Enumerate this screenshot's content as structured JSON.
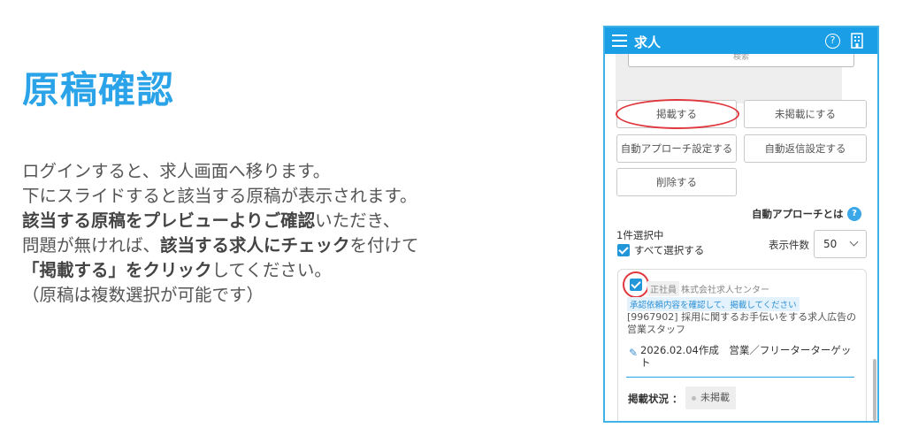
{
  "page": {
    "title": "原稿確認",
    "description": [
      [
        {
          "t": "ログインすると、求人画面へ移ります。",
          "b": false
        }
      ],
      [
        {
          "t": "下にスライドすると該当する原稿が表示されます。",
          "b": false
        }
      ],
      [
        {
          "t": "該当する原稿をプレビューよりご確認",
          "b": true
        },
        {
          "t": "いただき、",
          "b": false
        }
      ],
      [
        {
          "t": "問題が無ければ、",
          "b": false
        },
        {
          "t": "該当する求人にチェック",
          "b": true
        },
        {
          "t": "を付けて",
          "b": false
        }
      ],
      [
        {
          "t": "「掲載する」をクリック",
          "b": true
        },
        {
          "t": "してください。",
          "b": false
        }
      ],
      [
        {
          "t": "（原稿は複数選択が可能です）",
          "b": false
        }
      ]
    ]
  },
  "app": {
    "header_title": "求人",
    "help_icon": "?",
    "search_button": "検索",
    "buttons": {
      "publish": "掲載する",
      "unpublish": "未掲載にする",
      "auto_approach": "自動アプローチ設定する",
      "auto_reply": "自動返信設定する",
      "delete": "削除する"
    },
    "auto_approach_link": "自動アプローチとは",
    "auto_help_icon": "?",
    "selected_count": "1件選択中",
    "select_all": "すべて選択する",
    "per_page_label": "表示件数",
    "per_page_value": "50",
    "job": {
      "employment_type": "正社員",
      "company": "株式会社求人センター",
      "notice": "承認依頼内容を確認して、掲載してください",
      "title": "[9967902] 採用に関するお手伝いをする求人広告の営業スタッフ",
      "created": "2026.02.04作成　営業／フリーターターゲット",
      "status_label": "掲載状況 ：",
      "status_value": "未掲載"
    }
  },
  "colors": {
    "accent": "#2aa3e8",
    "appbar": "#1a9ee6",
    "highlight": "#e0383e"
  }
}
